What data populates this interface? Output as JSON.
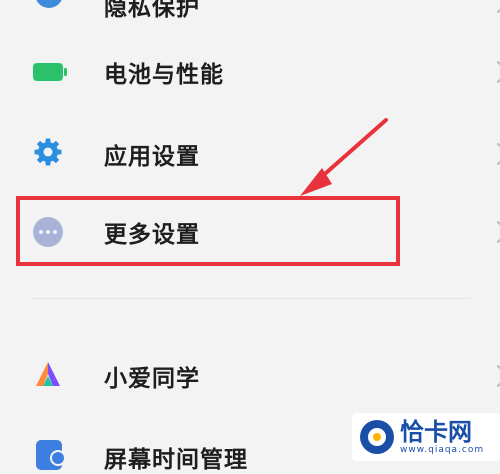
{
  "settings": {
    "items": [
      {
        "label": "隐私保护"
      },
      {
        "label": "电池与性能",
        "icon": "battery-icon"
      },
      {
        "label": "应用设置",
        "icon": "gear-icon"
      },
      {
        "label": "更多设置",
        "icon": "more-dots-icon"
      },
      {
        "label": "小爱同学",
        "icon": "xiaoai-icon"
      },
      {
        "label": "屏幕时间管理",
        "icon": "screen-time-icon"
      }
    ]
  },
  "watermark": {
    "title": "恰卡网",
    "url": "www.qiaqa.com"
  },
  "colors": {
    "highlight": "#e8323c",
    "battery": "#2bc169",
    "gear": "#2b8fe0",
    "more": "#a9b3d9"
  }
}
